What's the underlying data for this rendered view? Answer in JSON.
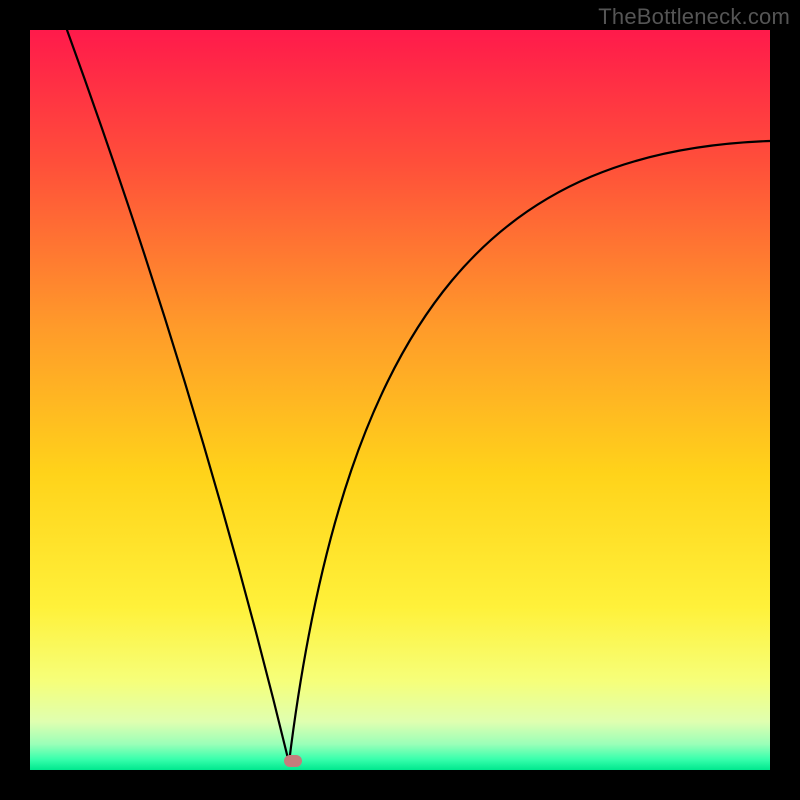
{
  "attribution": "TheBottleneck.com",
  "chart_data": {
    "type": "line",
    "title": "",
    "xlabel": "",
    "ylabel": "",
    "xlim": [
      0,
      100
    ],
    "ylim": [
      0,
      100
    ],
    "grid": false,
    "legend": false,
    "gradient_stops": [
      {
        "offset": 0,
        "color": "#ff1a4b"
      },
      {
        "offset": 0.18,
        "color": "#ff4f3a"
      },
      {
        "offset": 0.4,
        "color": "#ff9a2a"
      },
      {
        "offset": 0.6,
        "color": "#ffd31a"
      },
      {
        "offset": 0.78,
        "color": "#fff13a"
      },
      {
        "offset": 0.88,
        "color": "#f6ff7a"
      },
      {
        "offset": 0.935,
        "color": "#dfffb0"
      },
      {
        "offset": 0.965,
        "color": "#9affb8"
      },
      {
        "offset": 0.985,
        "color": "#3affad"
      },
      {
        "offset": 1.0,
        "color": "#00e88e"
      }
    ],
    "curve": {
      "vertex_x": 35,
      "vertex_y": 1,
      "left_endpoint": {
        "x": 5,
        "y": 100
      },
      "right_endpoint": {
        "x": 100,
        "y": 85
      },
      "stroke": "#000000",
      "stroke_width": 2.2
    },
    "marker": {
      "x": 35.5,
      "y": 1.2,
      "color": "#c47c7c"
    }
  }
}
